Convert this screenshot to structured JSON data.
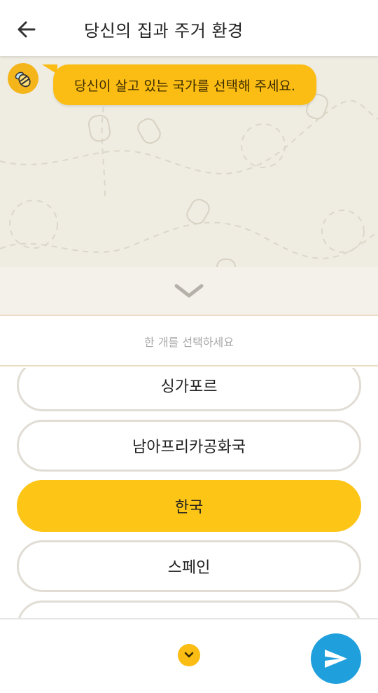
{
  "header": {
    "title": "당신의 집과 주거 환경",
    "back_icon": "arrow-left-icon"
  },
  "chat": {
    "avatar_icon": "bee-icon",
    "message": "당신이 살고 있는 국가를 선택해 주세요.",
    "bubble_color": "#fbbd14"
  },
  "collapse": {
    "icon": "chevron-down-icon"
  },
  "hint": "한 개를 선택하세요",
  "options": [
    {
      "label": "싱가포르",
      "selected": false
    },
    {
      "label": "남아프리카공화국",
      "selected": false
    },
    {
      "label": "한국",
      "selected": true
    },
    {
      "label": "스페인",
      "selected": false
    },
    {
      "label": "",
      "selected": false
    }
  ],
  "footer": {
    "scroll_icon": "chevron-down-circle-icon",
    "send_icon": "send-icon",
    "accent_color": "#1f9fdc"
  }
}
